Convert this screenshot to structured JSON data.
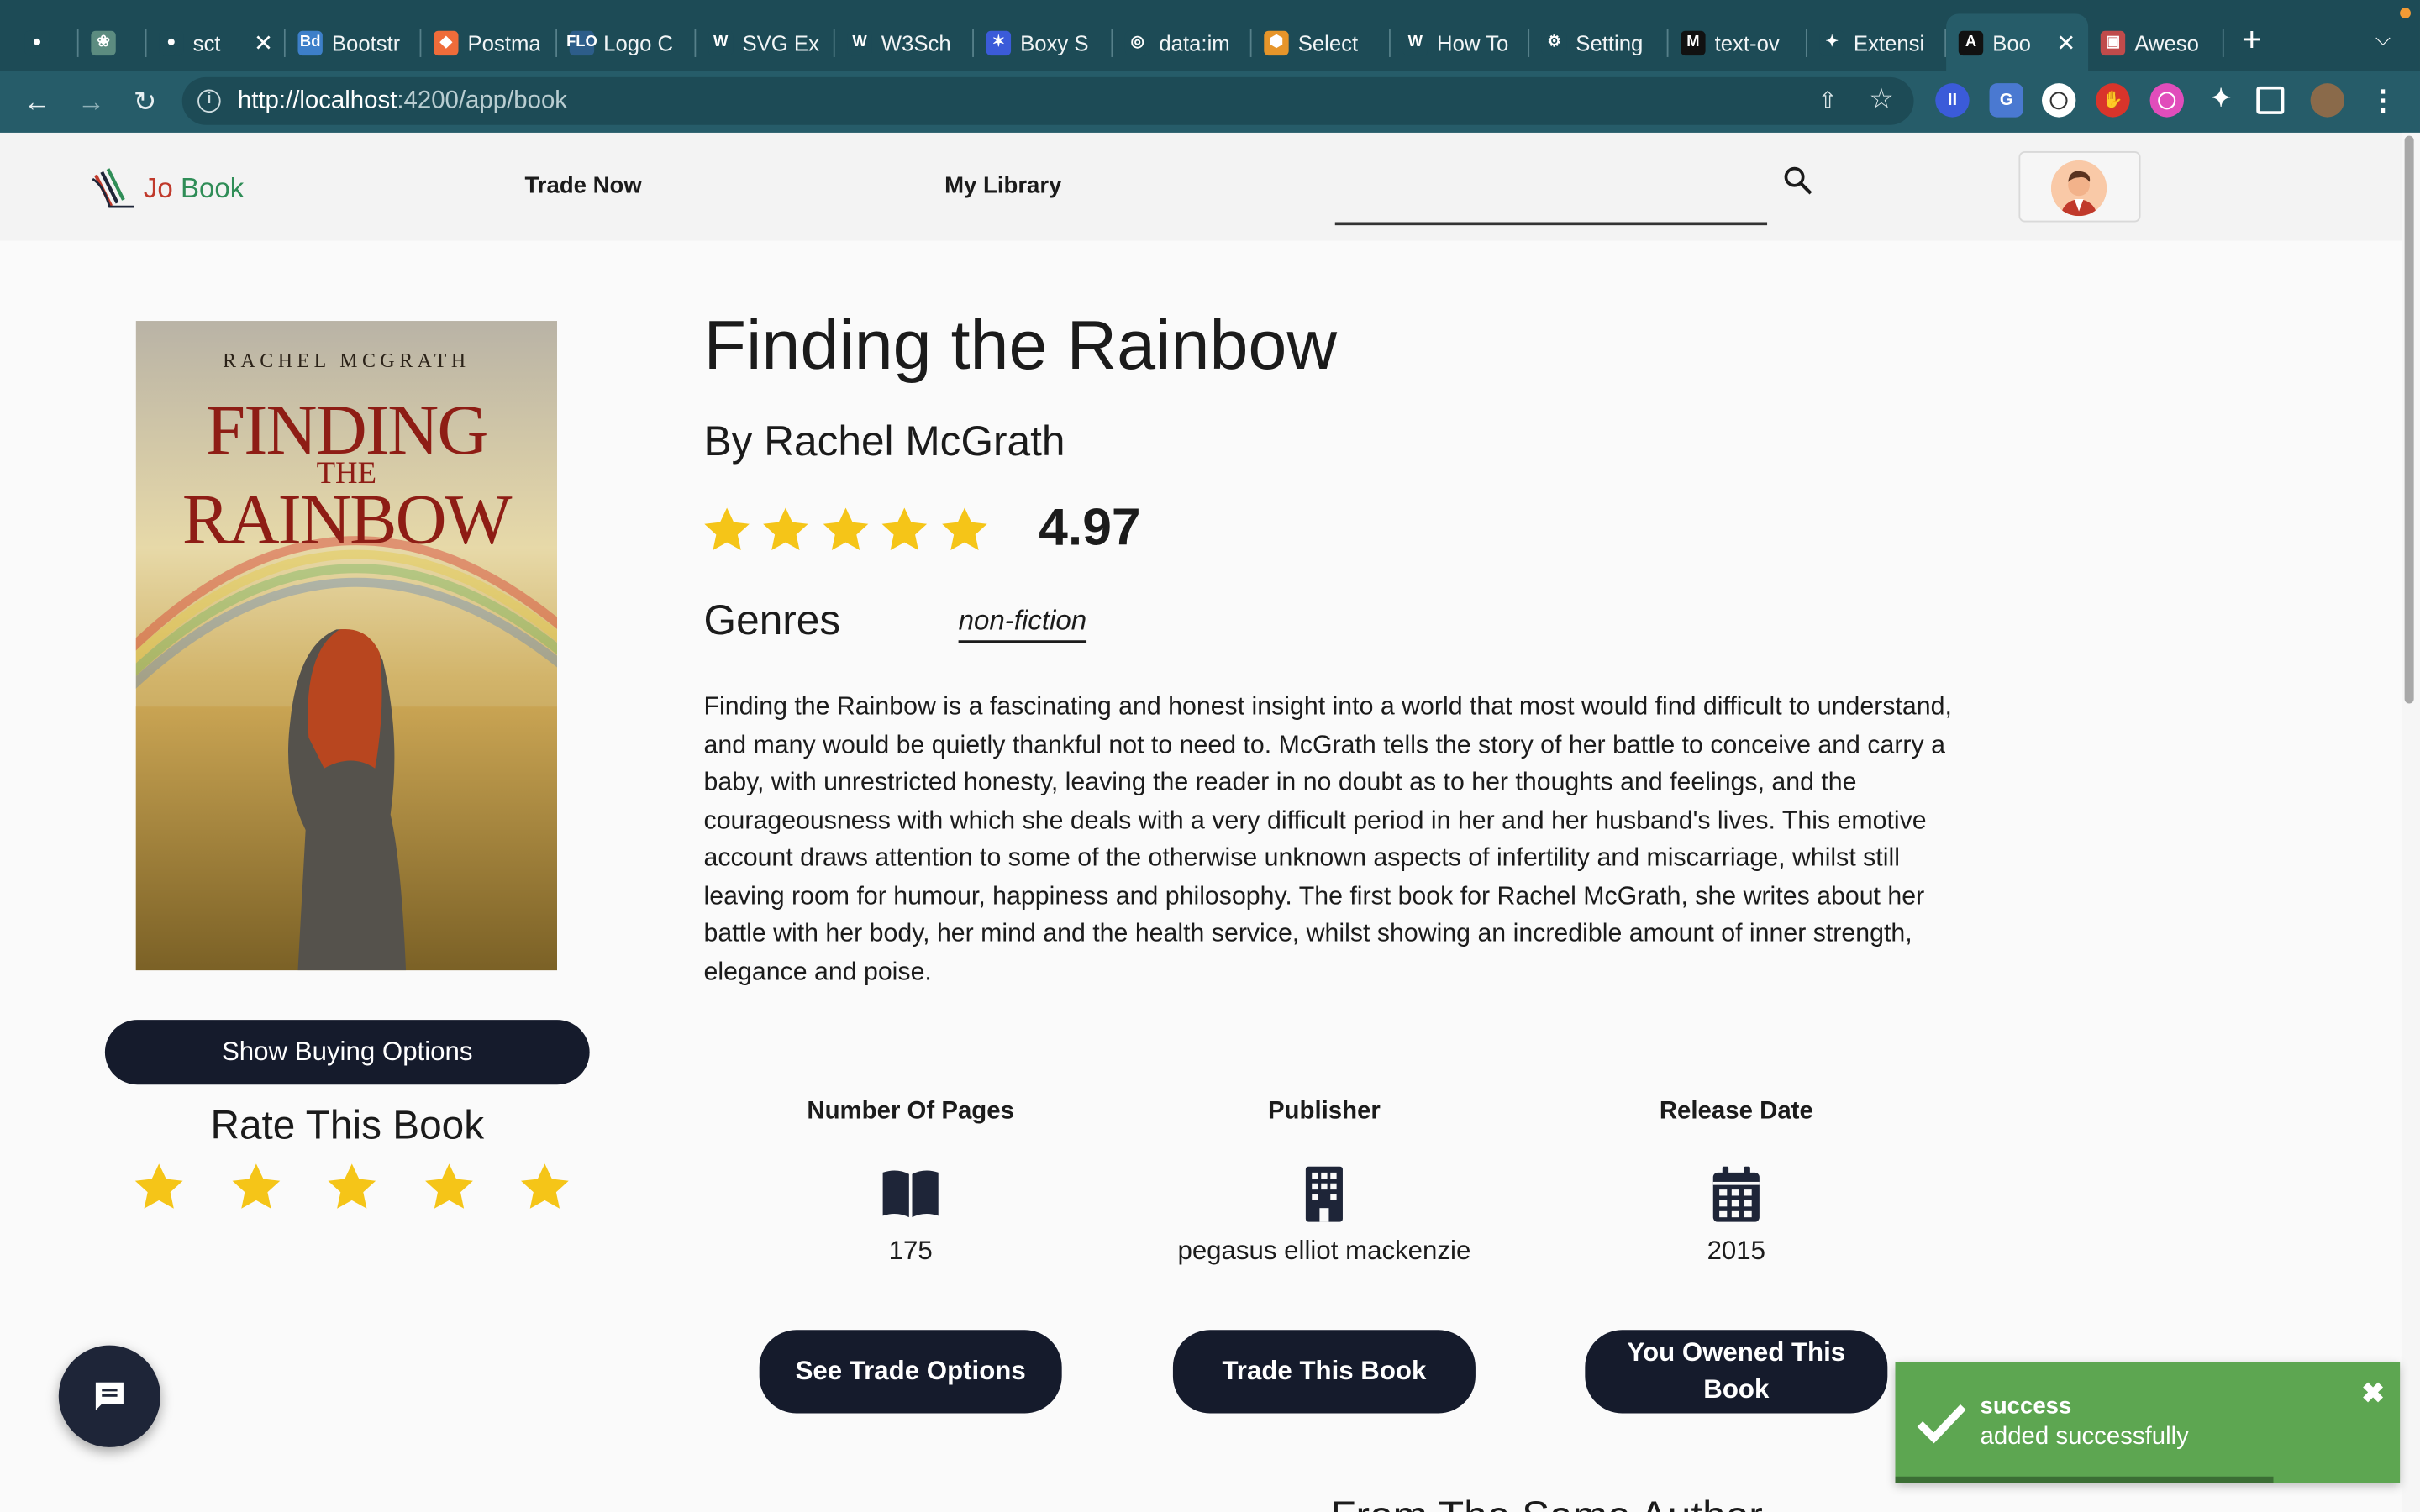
{
  "browser": {
    "tabs": [
      {
        "title": "",
        "fav": "github-icon",
        "color": "#1d4b56"
      },
      {
        "title": "",
        "fav": "openai-icon",
        "color": "#5c8c80"
      },
      {
        "title": "sct",
        "fav": "github-icon",
        "color": "#1d4b56",
        "close": "✕"
      },
      {
        "title": "Bootstr",
        "fav": "Bd",
        "color": "#3d7fc9"
      },
      {
        "title": "Postma",
        "fav": "postman-icon",
        "color": "#ef6c3a"
      },
      {
        "title": "Logo C",
        "fav": "FLO",
        "color": "#2d5d8a"
      },
      {
        "title": "SVG Ex",
        "fav": "w3-icon",
        "color": "#1d4b56"
      },
      {
        "title": "W3Sch",
        "fav": "w3-icon",
        "color": "#1d4b56"
      },
      {
        "title": "Boxy S",
        "fav": "boxy-icon",
        "color": "#3b5bd9"
      },
      {
        "title": "data:im",
        "fav": "globe-icon",
        "color": "#1d4b56"
      },
      {
        "title": "Select",
        "fav": "shield-icon",
        "color": "#e6952a"
      },
      {
        "title": "How To",
        "fav": "w3-icon",
        "color": "#1d4b56"
      },
      {
        "title": "Setting",
        "fav": "gear-icon",
        "color": "#1d4b56"
      },
      {
        "title": "text-ov",
        "fav": "M",
        "color": "#111111"
      },
      {
        "title": "Extensi",
        "fav": "puzzle-icon",
        "color": "#1d4b56"
      },
      {
        "title": "Boo",
        "fav": "angular-icon",
        "color": "#111111",
        "active": true,
        "close": "✕"
      },
      {
        "title": "Aweso",
        "fav": "awesome-icon",
        "color": "#c04b4b"
      }
    ],
    "new_tab": "+",
    "url_host": "http://localhost",
    "url_path": ":4200/app/book"
  },
  "header": {
    "logo_text_1": "Jo",
    "logo_text_2": "Book",
    "nav": [
      "Trade Now",
      "My Library"
    ],
    "search_placeholder": ""
  },
  "book": {
    "cover": {
      "author": "RACHEL MCGRATH",
      "title_1": "FINDING",
      "title_2": "THE",
      "title_3": "RAINBOW"
    },
    "title": "Finding the Rainbow",
    "author_line": "By Rachel McGrath",
    "rating": "4.97",
    "rating_stars": 5,
    "genres_label": "Genres",
    "genre": "non-fiction",
    "description": "Finding the Rainbow is a fascinating and honest insight into a world that most would find difficult to understand, and many would be quietly thankful not to need to. McGrath tells the story of her battle to conceive and carry a baby, with unrestricted honesty, leaving the reader in no doubt as to her thoughts and feelings, and the courageousness with which she deals with a very difficult period in her and her husband's lives. This emotive account draws attention to some of the otherwise unknown aspects of infertility and miscarriage, whilst still leaving room for humour, happiness and philosophy. The first book for Rachel McGrath, she writes about her battle with her body, her mind and the health service, whilst showing an incredible amount of inner strength, elegance and poise.",
    "stats": [
      {
        "label": "Number Of Pages",
        "icon": "book-open-icon",
        "value": "175"
      },
      {
        "label": "Publisher",
        "icon": "building-icon",
        "value": "pegasus elliot mackenzie"
      },
      {
        "label": "Release Date",
        "icon": "calendar-icon",
        "value": "2015"
      }
    ]
  },
  "actions": {
    "show_buying": "Show Buying Options",
    "rate_title": "Rate This Book",
    "rate_stars": 5,
    "see_trade": "See Trade Options",
    "trade_this": "Trade This Book",
    "owned": "You Owened This Book"
  },
  "more_heading": "From The Same Author",
  "toast": {
    "title": "success",
    "message": "added successfully",
    "close": "✖",
    "progress": 0.75
  },
  "colors": {
    "primary_dark": "#151b2c",
    "star": "#f5c518",
    "toast_green": "#5da651",
    "chrome": "#1d4b56"
  }
}
